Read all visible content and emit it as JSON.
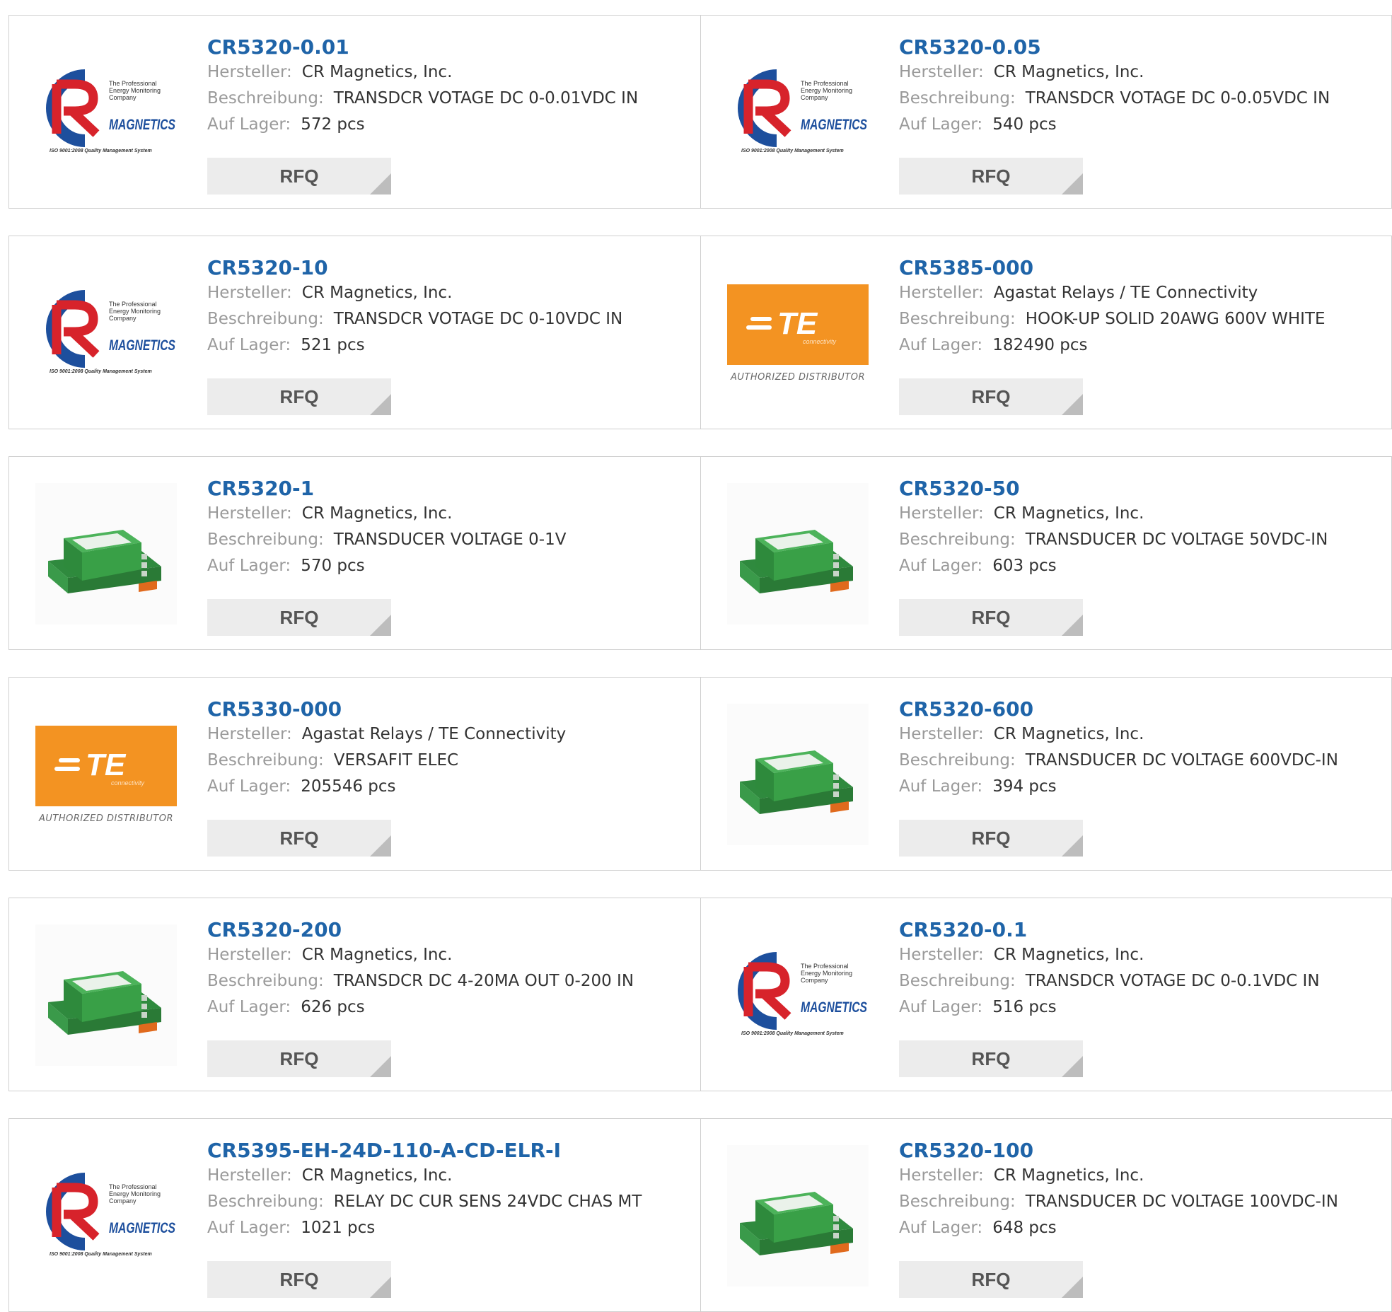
{
  "labels": {
    "manufacturer": "Hersteller:",
    "description": "Beschreibung:",
    "stock": "Auf Lager:"
  },
  "rfq_label": "RFQ",
  "colors": {
    "link": "#1f64a8",
    "te_orange": "#f39322",
    "cr_red": "#d7232b",
    "cr_blue": "#1d4f9d",
    "product_green": "#3a9a4a"
  },
  "logos": {
    "cr": {
      "line1": "The Professional",
      "line2": "Energy Monitoring",
      "line3": "Company",
      "word": "MAGNETICS",
      "footer": "ISO 9001:2008 Quality Management System"
    },
    "te": {
      "mark": "TE",
      "sub": "connectivity",
      "caption": "AUTHORIZED DISTRIBUTOR"
    }
  },
  "products": [
    {
      "part": "CR5320-0.01",
      "manufacturer": "CR Magnetics, Inc.",
      "description": "TRANSDCR VOTAGE DC 0-0.01VDC IN",
      "stock": "572 pcs",
      "image": "cr-logo"
    },
    {
      "part": "CR5320-0.05",
      "manufacturer": "CR Magnetics, Inc.",
      "description": "TRANSDCR VOTAGE DC 0-0.05VDC IN",
      "stock": "540 pcs",
      "image": "cr-logo"
    },
    {
      "part": "CR5320-10",
      "manufacturer": "CR Magnetics, Inc.",
      "description": "TRANSDCR VOTAGE DC 0-10VDC IN",
      "stock": "521 pcs",
      "image": "cr-logo"
    },
    {
      "part": "CR5385-000",
      "manufacturer": "Agastat Relays / TE Connectivity",
      "description": "HOOK-UP SOLID 20AWG 600V WHITE",
      "stock": "182490 pcs",
      "image": "te-logo"
    },
    {
      "part": "CR5320-1",
      "manufacturer": "CR Magnetics, Inc.",
      "description": "TRANSDUCER VOLTAGE 0-1V",
      "stock": "570 pcs",
      "image": "transducer"
    },
    {
      "part": "CR5320-50",
      "manufacturer": "CR Magnetics, Inc.",
      "description": "TRANSDUCER DC VOLTAGE 50VDC-IN",
      "stock": "603 pcs",
      "image": "transducer"
    },
    {
      "part": "CR5330-000",
      "manufacturer": "Agastat Relays / TE Connectivity",
      "description": "VERSAFIT ELEC",
      "stock": "205546 pcs",
      "image": "te-logo"
    },
    {
      "part": "CR5320-600",
      "manufacturer": "CR Magnetics, Inc.",
      "description": "TRANSDUCER DC VOLTAGE 600VDC-IN",
      "stock": "394 pcs",
      "image": "transducer"
    },
    {
      "part": "CR5320-200",
      "manufacturer": "CR Magnetics, Inc.",
      "description": "TRANSDCR DC 4-20MA OUT 0-200 IN",
      "stock": "626 pcs",
      "image": "transducer"
    },
    {
      "part": "CR5320-0.1",
      "manufacturer": "CR Magnetics, Inc.",
      "description": "TRANSDCR VOTAGE DC 0-0.1VDC IN",
      "stock": "516 pcs",
      "image": "cr-logo"
    },
    {
      "part": "CR5395-EH-24D-110-A-CD-ELR-I",
      "manufacturer": "CR Magnetics, Inc.",
      "description": "RELAY DC CUR SENS 24VDC CHAS MT",
      "stock": "1021 pcs",
      "image": "cr-logo"
    },
    {
      "part": "CR5320-100",
      "manufacturer": "CR Magnetics, Inc.",
      "description": "TRANSDUCER DC VOLTAGE 100VDC-IN",
      "stock": "648 pcs",
      "image": "transducer"
    }
  ]
}
